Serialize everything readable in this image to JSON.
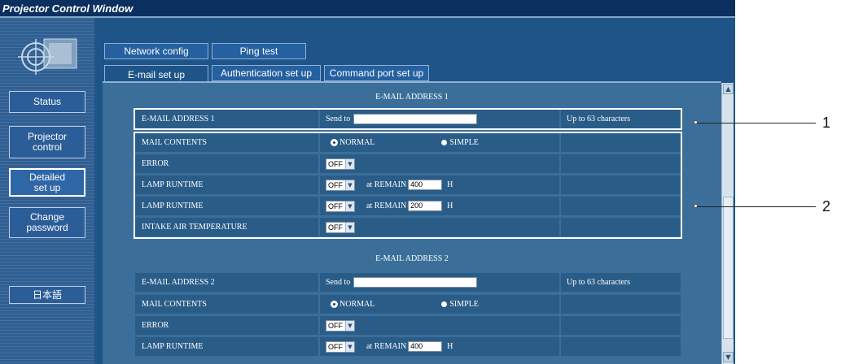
{
  "window": {
    "title": "Projector Control Window"
  },
  "sidebar": {
    "buttons": [
      {
        "label": "Status"
      },
      {
        "label": "Projector\ncontrol"
      },
      {
        "label": "Detailed\nset up"
      },
      {
        "label": "Change\npassword"
      },
      {
        "label": "日本語"
      }
    ]
  },
  "tabs": {
    "row1": [
      {
        "label": "Network config"
      },
      {
        "label": "Ping test"
      }
    ],
    "row2": [
      {
        "label": "E-mail set up"
      },
      {
        "label": "Authentication set up"
      },
      {
        "label": "Command port set up"
      }
    ],
    "selected": "E-mail set up"
  },
  "email1": {
    "section_title": "E-MAIL ADDRESS 1",
    "address_label": "E-MAIL ADDRESS 1",
    "send_to_label": "Send to",
    "address_value": "",
    "hint": "Up to 63 characters",
    "mail_contents_label": "MAIL CONTENTS",
    "normal_label": "NORMAL",
    "simple_label": "SIMPLE",
    "mail_contents_selected": "NORMAL",
    "error_label": "ERROR",
    "error_value": "OFF",
    "lamp1_label": "LAMP RUNTIME",
    "lamp1_value": "OFF",
    "lamp1_at_label": "at REMAIN",
    "lamp1_hours": "400",
    "lamp1_unit": "H",
    "lamp2_label": "LAMP RUNTIME",
    "lamp2_value": "OFF",
    "lamp2_at_label": "at REMAIN",
    "lamp2_hours": "200",
    "lamp2_unit": "H",
    "intake_label": "INTAKE AIR TEMPERATURE",
    "intake_value": "OFF"
  },
  "email2": {
    "section_title": "E-MAIL ADDRESS 2",
    "address_label": "E-MAIL ADDRESS 2",
    "send_to_label": "Send to",
    "address_value": "",
    "hint": "Up to 63 characters",
    "mail_contents_label": "MAIL CONTENTS",
    "normal_label": "NORMAL",
    "simple_label": "SIMPLE",
    "mail_contents_selected": "NORMAL",
    "error_label": "ERROR",
    "error_value": "OFF",
    "lamp1_label": "LAMP RUNTIME",
    "lamp1_value": "OFF",
    "lamp1_at_label": "at REMAIN",
    "lamp1_hours": "400",
    "lamp1_unit": "H"
  },
  "callouts": [
    {
      "number": "1"
    },
    {
      "number": "2"
    }
  ],
  "colors": {
    "title_bar": "#0b2f5f",
    "panel": "#1f5488",
    "row": "#2a5c88",
    "content_bg": "#3b6f99"
  }
}
